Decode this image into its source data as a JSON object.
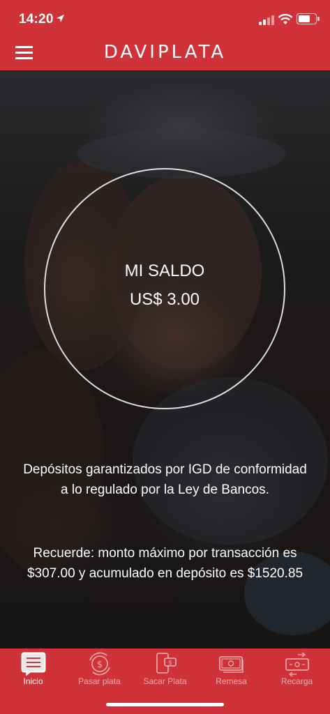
{
  "status_bar": {
    "time": "14:20"
  },
  "header": {
    "brand": "DAVIPLATA"
  },
  "balance": {
    "title": "MI SALDO",
    "amount": "US$ 3.00"
  },
  "info": {
    "guarantee_text": "Depósitos garantizados por IGD de conformidad a lo regulado por la Ley de Bancos.",
    "limits_text": "Recuerde: monto máximo por transacción es $307.00 y acumulado en depósito es $1520.85"
  },
  "tabs": [
    {
      "label": "Inicio",
      "icon": "home-list-icon",
      "active": true
    },
    {
      "label": "Pasar plata",
      "icon": "transfer-money-icon",
      "active": false
    },
    {
      "label": "Sacar Plata",
      "icon": "withdraw-phone-icon",
      "active": false
    },
    {
      "label": "Remesa",
      "icon": "remittance-bill-icon",
      "active": false
    },
    {
      "label": "Recarga",
      "icon": "recharge-icon",
      "active": false
    }
  ],
  "colors": {
    "brand_red": "#cf3339"
  }
}
